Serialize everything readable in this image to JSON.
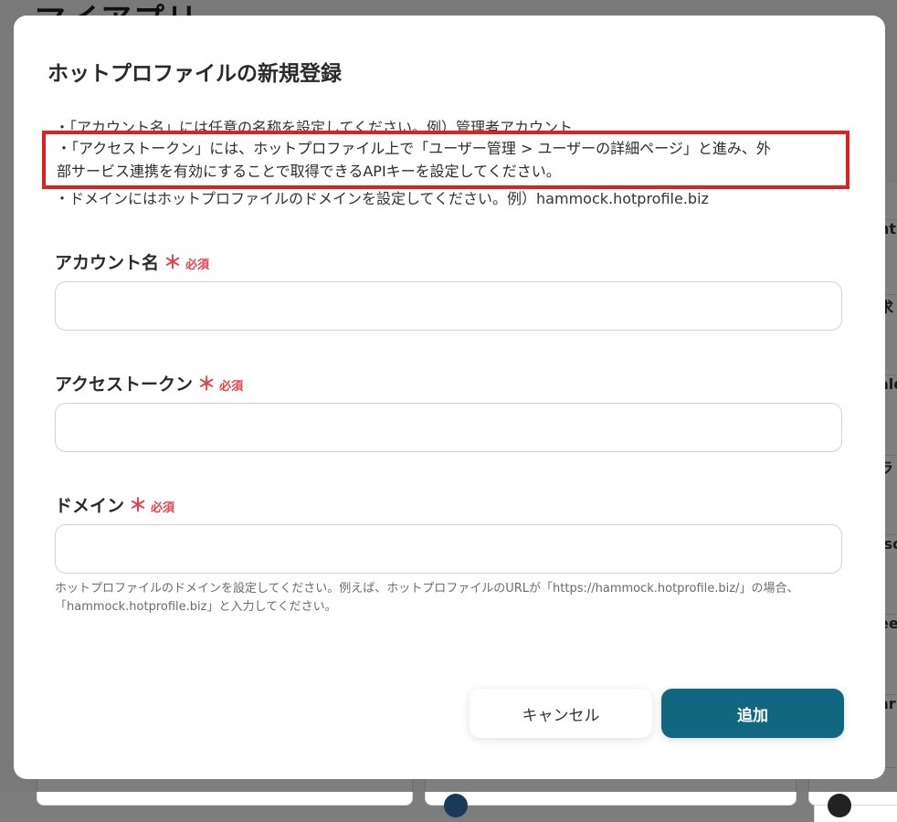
{
  "background": {
    "app_title": "マイアプリ",
    "right_fragments": [
      "nt",
      "求",
      "ale",
      "ラ",
      "isc",
      "ee",
      "ar"
    ]
  },
  "modal": {
    "title": "ホットプロファイルの新規登録",
    "desc_line1": "・「アカウント名」には任意の名称を設定してください。例）管理者アカウント",
    "desc_line2a": "・「アクセストークン」には、ホットプロファイル上で「ユーザー管理 > ユーザーの詳細ページ」と進み、外",
    "desc_line2b": "部サービス連携を有効にすることで取得できるAPIキーを設定してください。",
    "desc_line3": "・ドメインにはホットプロファイルのドメインを設定してください。例）hammock.hotprofile.biz",
    "required_label": "必須",
    "required_star": "＊",
    "fields": [
      {
        "label": "アカウント名",
        "value": "",
        "placeholder": ""
      },
      {
        "label": "アクセストークン",
        "value": "",
        "placeholder": ""
      },
      {
        "label": "ドメイン",
        "value": "",
        "placeholder": ""
      }
    ],
    "help_line1": "ホットプロファイルのドメインを設定してください。例えば、ホットプロファイルのURLが「https://hammock.hotprofile.biz/」の場合、",
    "help_line2": "「hammock.hotprofile.biz」と入力してください。",
    "cancel_label": "キャンセル",
    "add_label": "追加"
  },
  "colors": {
    "primary": "#116680",
    "required": "#e5424d",
    "highlight_border": "#e02020"
  }
}
